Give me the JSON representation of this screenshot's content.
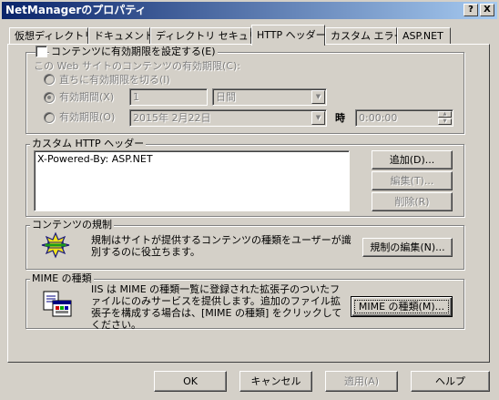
{
  "window": {
    "title": "NetManagerのプロパティ",
    "help_btn": "?",
    "close_btn": "X"
  },
  "tabs": [
    {
      "label": "仮想ディレクトリ"
    },
    {
      "label": "ドキュメント"
    },
    {
      "label": "ディレクトリ セキュリティ"
    },
    {
      "label": "HTTP ヘッダー"
    },
    {
      "label": "カスタム エラー"
    },
    {
      "label": "ASP.NET"
    }
  ],
  "expiration": {
    "checkbox_label": "コンテンツに有効期限を設定する(E)",
    "subtitle": "この Web サイトのコンテンツの有効期限(C):",
    "radio_immediate": "直ちに有効期限を切る(I)",
    "radio_period": "有効期間(X)",
    "period_value": "1",
    "period_unit": "日間",
    "radio_date": "有効期限(O)",
    "date_value": "2015年  2月22日",
    "time_label": "時",
    "time_value": "0:00:00"
  },
  "custom_headers": {
    "legend": "カスタム HTTP ヘッダー",
    "items": [
      "X-Powered-By: ASP.NET"
    ],
    "add_btn": "追加(D)...",
    "edit_btn": "編集(T)...",
    "delete_btn": "削除(R)"
  },
  "content_rating": {
    "legend": "コンテンツの規制",
    "description": "規制はサイトが提供するコンテンツの種類をユーザーが識別するのに役立ちます。",
    "edit_btn": "規制の編集(N)..."
  },
  "mime": {
    "legend": "MIME の種類",
    "description": "IIS は MIME の種類一覧に登録された拡張子のついたファイルにのみサービスを提供します。追加のファイル拡張子を構成する場合は、[MIME の種類] をクリックしてください。",
    "btn": "MIME の種類(M)..."
  },
  "footer": {
    "ok": "OK",
    "cancel": "キャンセル",
    "apply": "適用(A)",
    "help": "ヘルプ"
  }
}
